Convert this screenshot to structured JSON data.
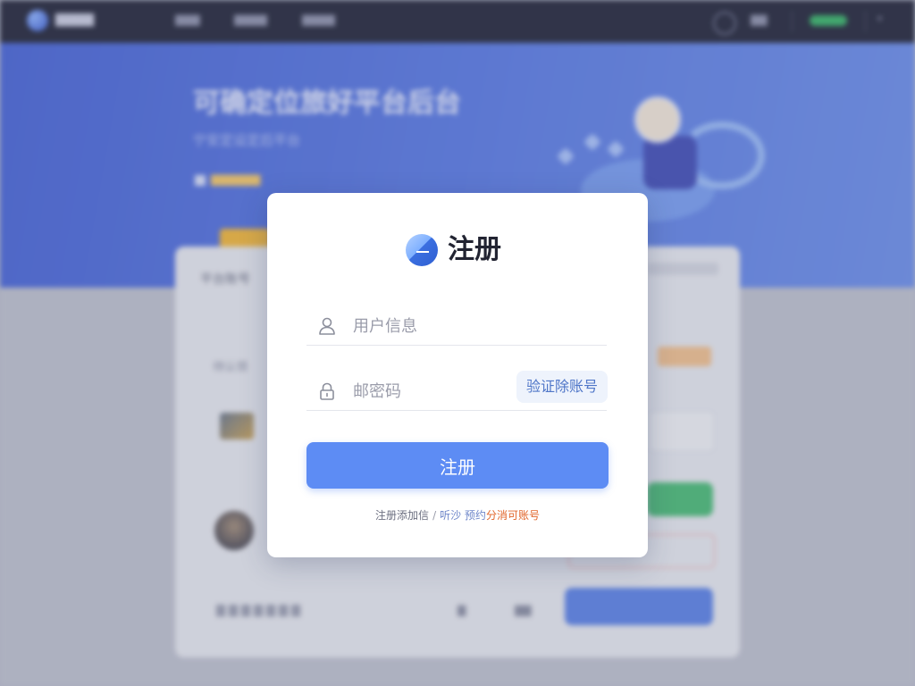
{
  "background": {
    "hero_title": "可确定位旅好平台后台",
    "hero_sub": "宁安定设定后平台",
    "panel_title": "平台账号",
    "panel_row": "待认领"
  },
  "modal": {
    "title": "注册",
    "username_placeholder": "用户信息",
    "password_placeholder": "邮密码",
    "verify_button": "验证除账号",
    "submit_button": "注册",
    "footer_text": "注册添加信",
    "footer_sep": "/",
    "footer_link_1": "听沙 预约",
    "footer_link_2": "分消可账号"
  },
  "icons": {
    "user": "user-icon",
    "lock": "lock-icon",
    "logo": "app-logo-icon"
  },
  "colors": {
    "accent": "#5d8cf4",
    "link_orange": "#e1652a",
    "verify_text": "#4f76c8"
  }
}
